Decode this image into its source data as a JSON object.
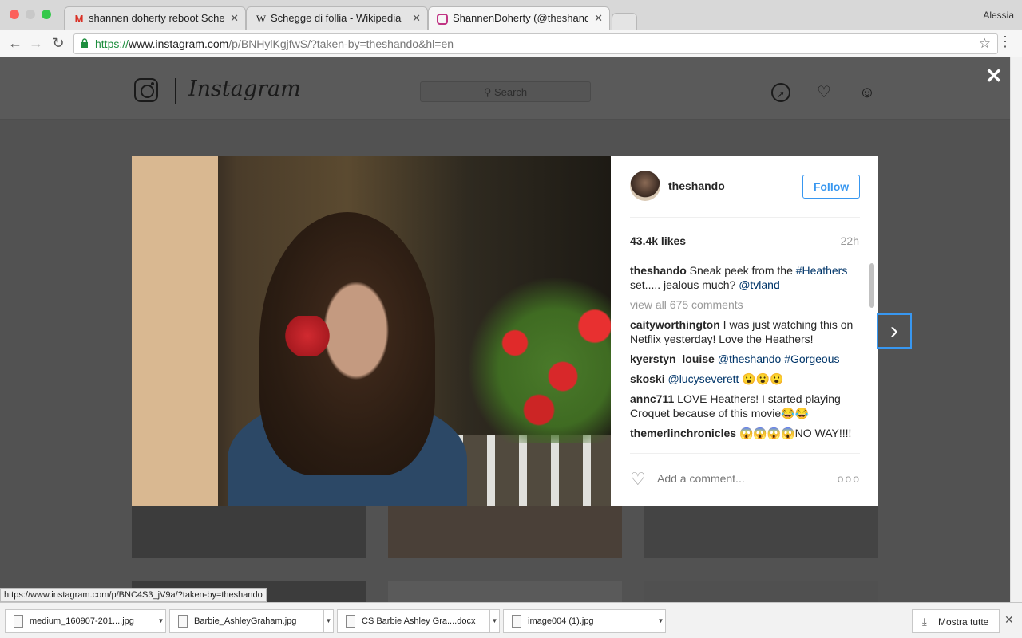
{
  "browser": {
    "user": "Alessia",
    "tabs": [
      {
        "title": "shannen doherty reboot Sche",
        "favicon": "gmail-icon"
      },
      {
        "title": "Schegge di follia - Wikipedia",
        "favicon": "wikipedia-icon"
      },
      {
        "title": "ShannenDoherty (@theshando",
        "favicon": "instagram-icon"
      }
    ],
    "url_scheme": "https://",
    "url_host": "www.instagram.com",
    "url_path": "/p/BNHylKgjfwS/?taken-by=theshando&hl=en",
    "status_url": "https://www.instagram.com/p/BNC4S3_jV9a/?taken-by=theshando"
  },
  "instagram": {
    "wordmark": "Instagram",
    "search_placeholder": "Search",
    "post": {
      "username": "theshando",
      "follow_label": "Follow",
      "likes": "43.4k likes",
      "time": "22h",
      "caption_user": "theshando",
      "caption_text_1": "Sneak peek from the ",
      "caption_tag": "#Heathers",
      "caption_text_2": " set..... jealous much? ",
      "caption_mention": "@tvland",
      "view_all": "view all 675 comments",
      "comments": [
        {
          "user": "caityworthington",
          "text": "I was just watching this on Netflix yesterday! Love the Heathers!"
        },
        {
          "user": "kyerstyn_louise",
          "text": "@theshando #Gorgeous"
        },
        {
          "user": "skoski",
          "text": "@lucyseverett 😮😮😮"
        },
        {
          "user": "annc711",
          "text": "LOVE Heathers! I started playing Croquet because of this movie😂😂"
        },
        {
          "user": "themerlinchronicles",
          "text": "😱😱😱😱NO WAY!!!!"
        }
      ],
      "add_comment_placeholder": "Add a comment...",
      "more": "ooo"
    }
  },
  "downloads": {
    "items": [
      "medium_160907-201....jpg",
      "Barbie_AshleyGraham.jpg",
      "CS Barbie Ashley Gra....docx",
      "image004 (1).jpg"
    ],
    "show_all": "Mostra tutte"
  }
}
